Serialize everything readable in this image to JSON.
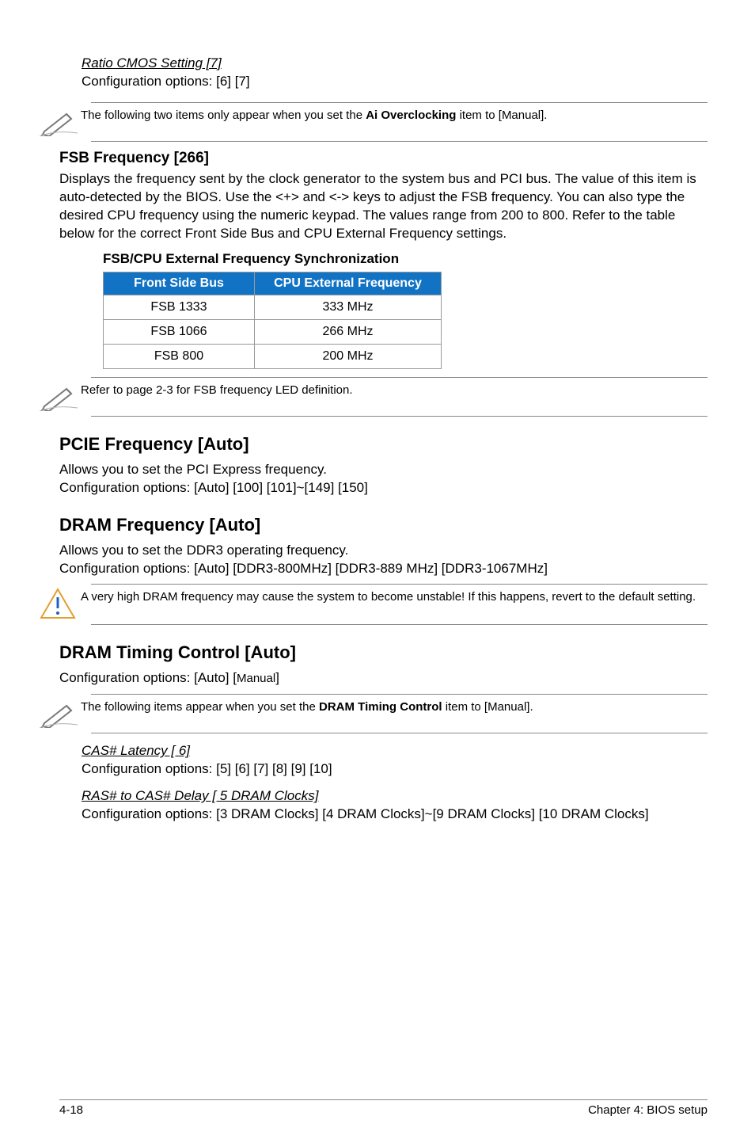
{
  "ratio_cmos": {
    "heading": "Ratio CMOS Setting [7]",
    "text": "Configuration options: [6] [7]"
  },
  "note1": "The following two items only appear when you set the ",
  "note1_bold": "Ai Overclocking",
  "note1_tail": " item to [Manual].",
  "fsb_freq": {
    "heading": "FSB Frequency [266]",
    "text": "Displays the frequency sent by the clock generator to the system bus and PCI bus. The value of this item is auto-detected by the BIOS. Use the <+> and <-> keys to adjust the FSB frequency. You can also type the desired CPU frequency using the numeric keypad. The values range from 200 to 800. Refer to the table below for the correct Front Side Bus and CPU External Frequency settings."
  },
  "table_title": "FSB/CPU External Frequency Synchronization",
  "table_headers": [
    "Front Side Bus",
    "CPU External Frequency"
  ],
  "table_rows": [
    [
      "FSB 1333",
      "333 MHz"
    ],
    [
      "FSB 1066",
      "266 MHz"
    ],
    [
      "FSB 800",
      "200 MHz"
    ]
  ],
  "note2": "Refer to page 2-3 for FSB frequency LED definition.",
  "pcie": {
    "heading": "PCIE Frequency [Auto]",
    "line1": "Allows you to set the PCI Express frequency.",
    "line2": "Configuration options: [Auto] [100] [101]~[149] [150]"
  },
  "dram_freq": {
    "heading": "DRAM Frequency [Auto]",
    "line1": "Allows you to set the DDR3 operating frequency.",
    "line2": "Configuration options: [Auto] [DDR3-800MHz] [DDR3-889 MHz] [DDR3-1067MHz]"
  },
  "warn_note": "A very high DRAM frequency may cause the system to become unstable! If this happens, revert to the default setting.",
  "dram_timing": {
    "heading": "DRAM Timing Control [Auto]",
    "line1_a": "Configuration options: [Auto] [",
    "line1_b": "Manual",
    "line1_c": "]"
  },
  "note3_a": "The following items appear when you set the ",
  "note3_bold": "DRAM Timing Control",
  "note3_b": " item to [Manual].",
  "cas": {
    "heading": "CAS# Latency [ 6]",
    "text": "Configuration options: [5] [6] [7] [8] [9] [10]"
  },
  "ras": {
    "heading": "RAS# to CAS# Delay [ 5 DRAM Clocks]",
    "text": "Configuration options: [3 DRAM Clocks] [4 DRAM Clocks]~[9 DRAM Clocks] [10 DRAM Clocks]"
  },
  "footer_left": "4-18",
  "footer_right": "Chapter 4: BIOS setup"
}
